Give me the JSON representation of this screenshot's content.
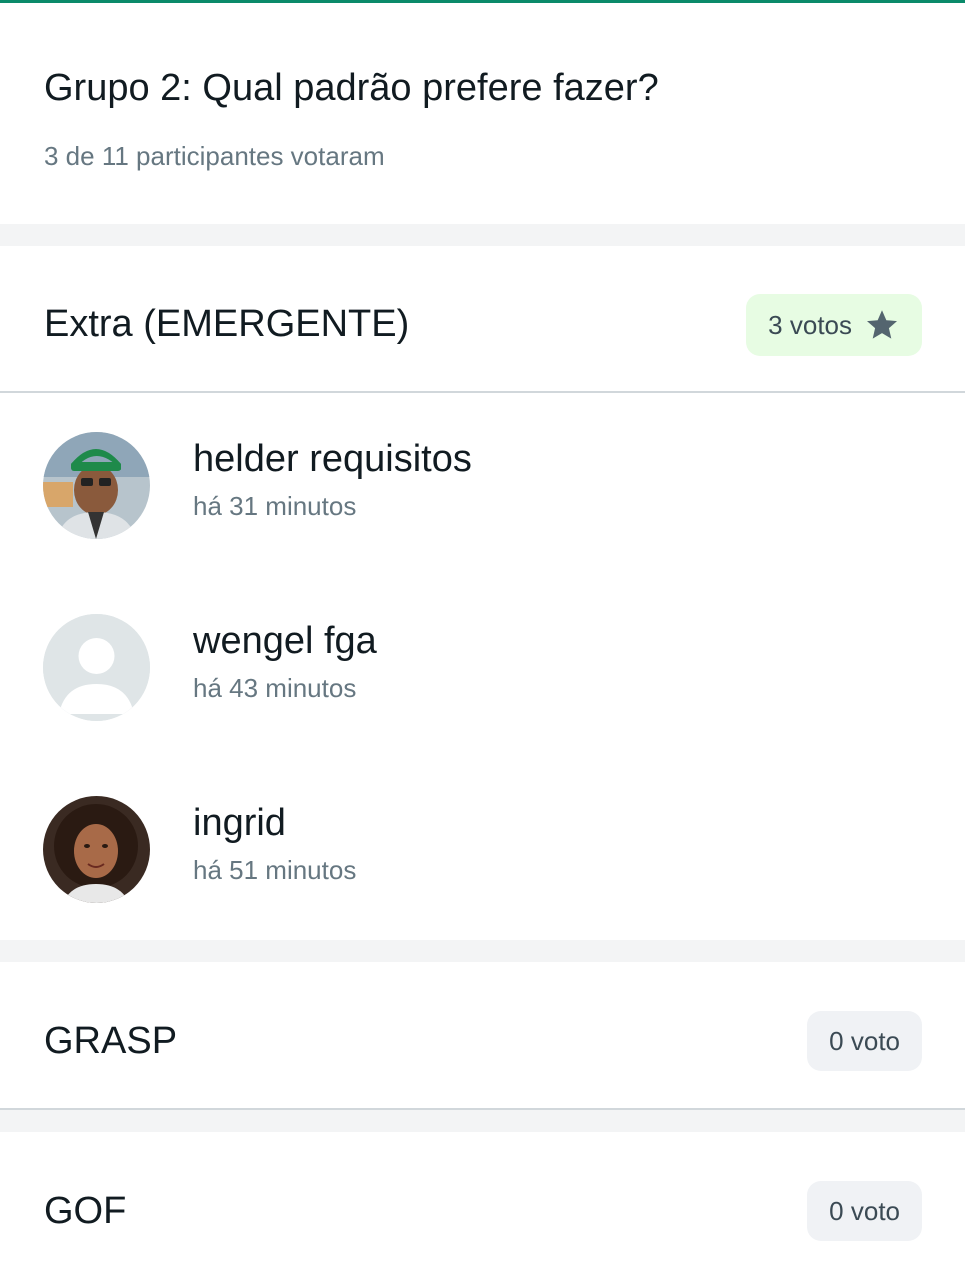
{
  "poll": {
    "title": "Grupo 2: Qual padrão prefere fazer?",
    "summary": "3 de 11 participantes votaram"
  },
  "options": [
    {
      "label": "Extra (EMERGENTE)",
      "votes_label": "3 votos",
      "votes": 3,
      "winner_icon": "star-icon",
      "voters": [
        {
          "name": "helder requisitos",
          "time": "há 31 minutos",
          "avatar": "photo"
        },
        {
          "name": "wengel fga",
          "time": "há 43 minutos",
          "avatar": "default-person-icon"
        },
        {
          "name": "ingrid",
          "time": "há 51 minutos",
          "avatar": "photo"
        }
      ]
    },
    {
      "label": "GRASP",
      "votes_label": "0 voto",
      "votes": 0
    },
    {
      "label": "GOF",
      "votes_label": "0 voto",
      "votes": 0
    }
  ],
  "colors": {
    "accent": "#0a8a6a",
    "winner_badge_bg": "#e7fce3",
    "zero_badge_bg": "#f0f2f5",
    "primary_text": "#111b21",
    "secondary_text": "#667781"
  }
}
